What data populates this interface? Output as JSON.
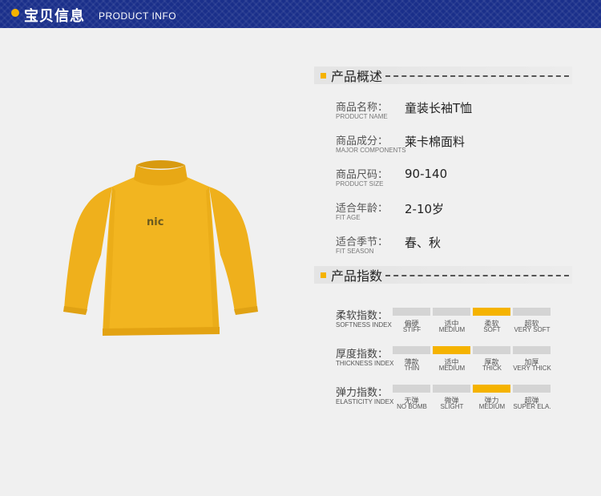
{
  "header": {
    "title": "宝贝信息",
    "subtitle": "PRODUCT INFO",
    "bg_color": "#1a2f8a",
    "accent_color": "#f5b300"
  },
  "product_image": {
    "garment_color": "#f0b41e",
    "chest_print": "nic"
  },
  "overview": {
    "title": "产品概述",
    "rows": [
      {
        "label_cn": "商品名称：",
        "label_en": "PRODUCT NAME",
        "value": "童装长袖T恤"
      },
      {
        "label_cn": "商品成分：",
        "label_en": "MAJOR COMPONENTS",
        "value": "莱卡棉面料"
      },
      {
        "label_cn": "商品尺码：",
        "label_en": "PRODUCT SIZE",
        "value": "90-140"
      },
      {
        "label_cn": "适合年龄：",
        "label_en": "FIT AGE",
        "value": "2-10岁"
      },
      {
        "label_cn": "适合季节：",
        "label_en": "FIT SEASON",
        "value": "春、秋"
      }
    ]
  },
  "indices": {
    "title": "产品指数",
    "rows": [
      {
        "label_cn": "柔软指数：",
        "label_en": "SOFTNESS INDEX",
        "selected": 2,
        "options": [
          {
            "cn": "偏硬",
            "en": "STIFF"
          },
          {
            "cn": "适中",
            "en": "MEDIUM"
          },
          {
            "cn": "柔软",
            "en": "SOFT"
          },
          {
            "cn": "超软",
            "en": "VERY SOFT"
          }
        ]
      },
      {
        "label_cn": "厚度指数：",
        "label_en": "THICKNESS INDEX",
        "selected": 1,
        "options": [
          {
            "cn": "薄款",
            "en": "THIN"
          },
          {
            "cn": "适中",
            "en": "MEDIUM"
          },
          {
            "cn": "厚款",
            "en": "THICK"
          },
          {
            "cn": "加厚",
            "en": "VERY THICK"
          }
        ]
      },
      {
        "label_cn": "弹力指数：",
        "label_en": "ELASTICITY INDEX",
        "selected": 2,
        "options": [
          {
            "cn": "无弹",
            "en": "NO BOMB"
          },
          {
            "cn": "微弹",
            "en": "SLIGHT"
          },
          {
            "cn": "弹力",
            "en": "MEDIUM"
          },
          {
            "cn": "超弹",
            "en": "SUPER ELA."
          }
        ]
      }
    ]
  }
}
